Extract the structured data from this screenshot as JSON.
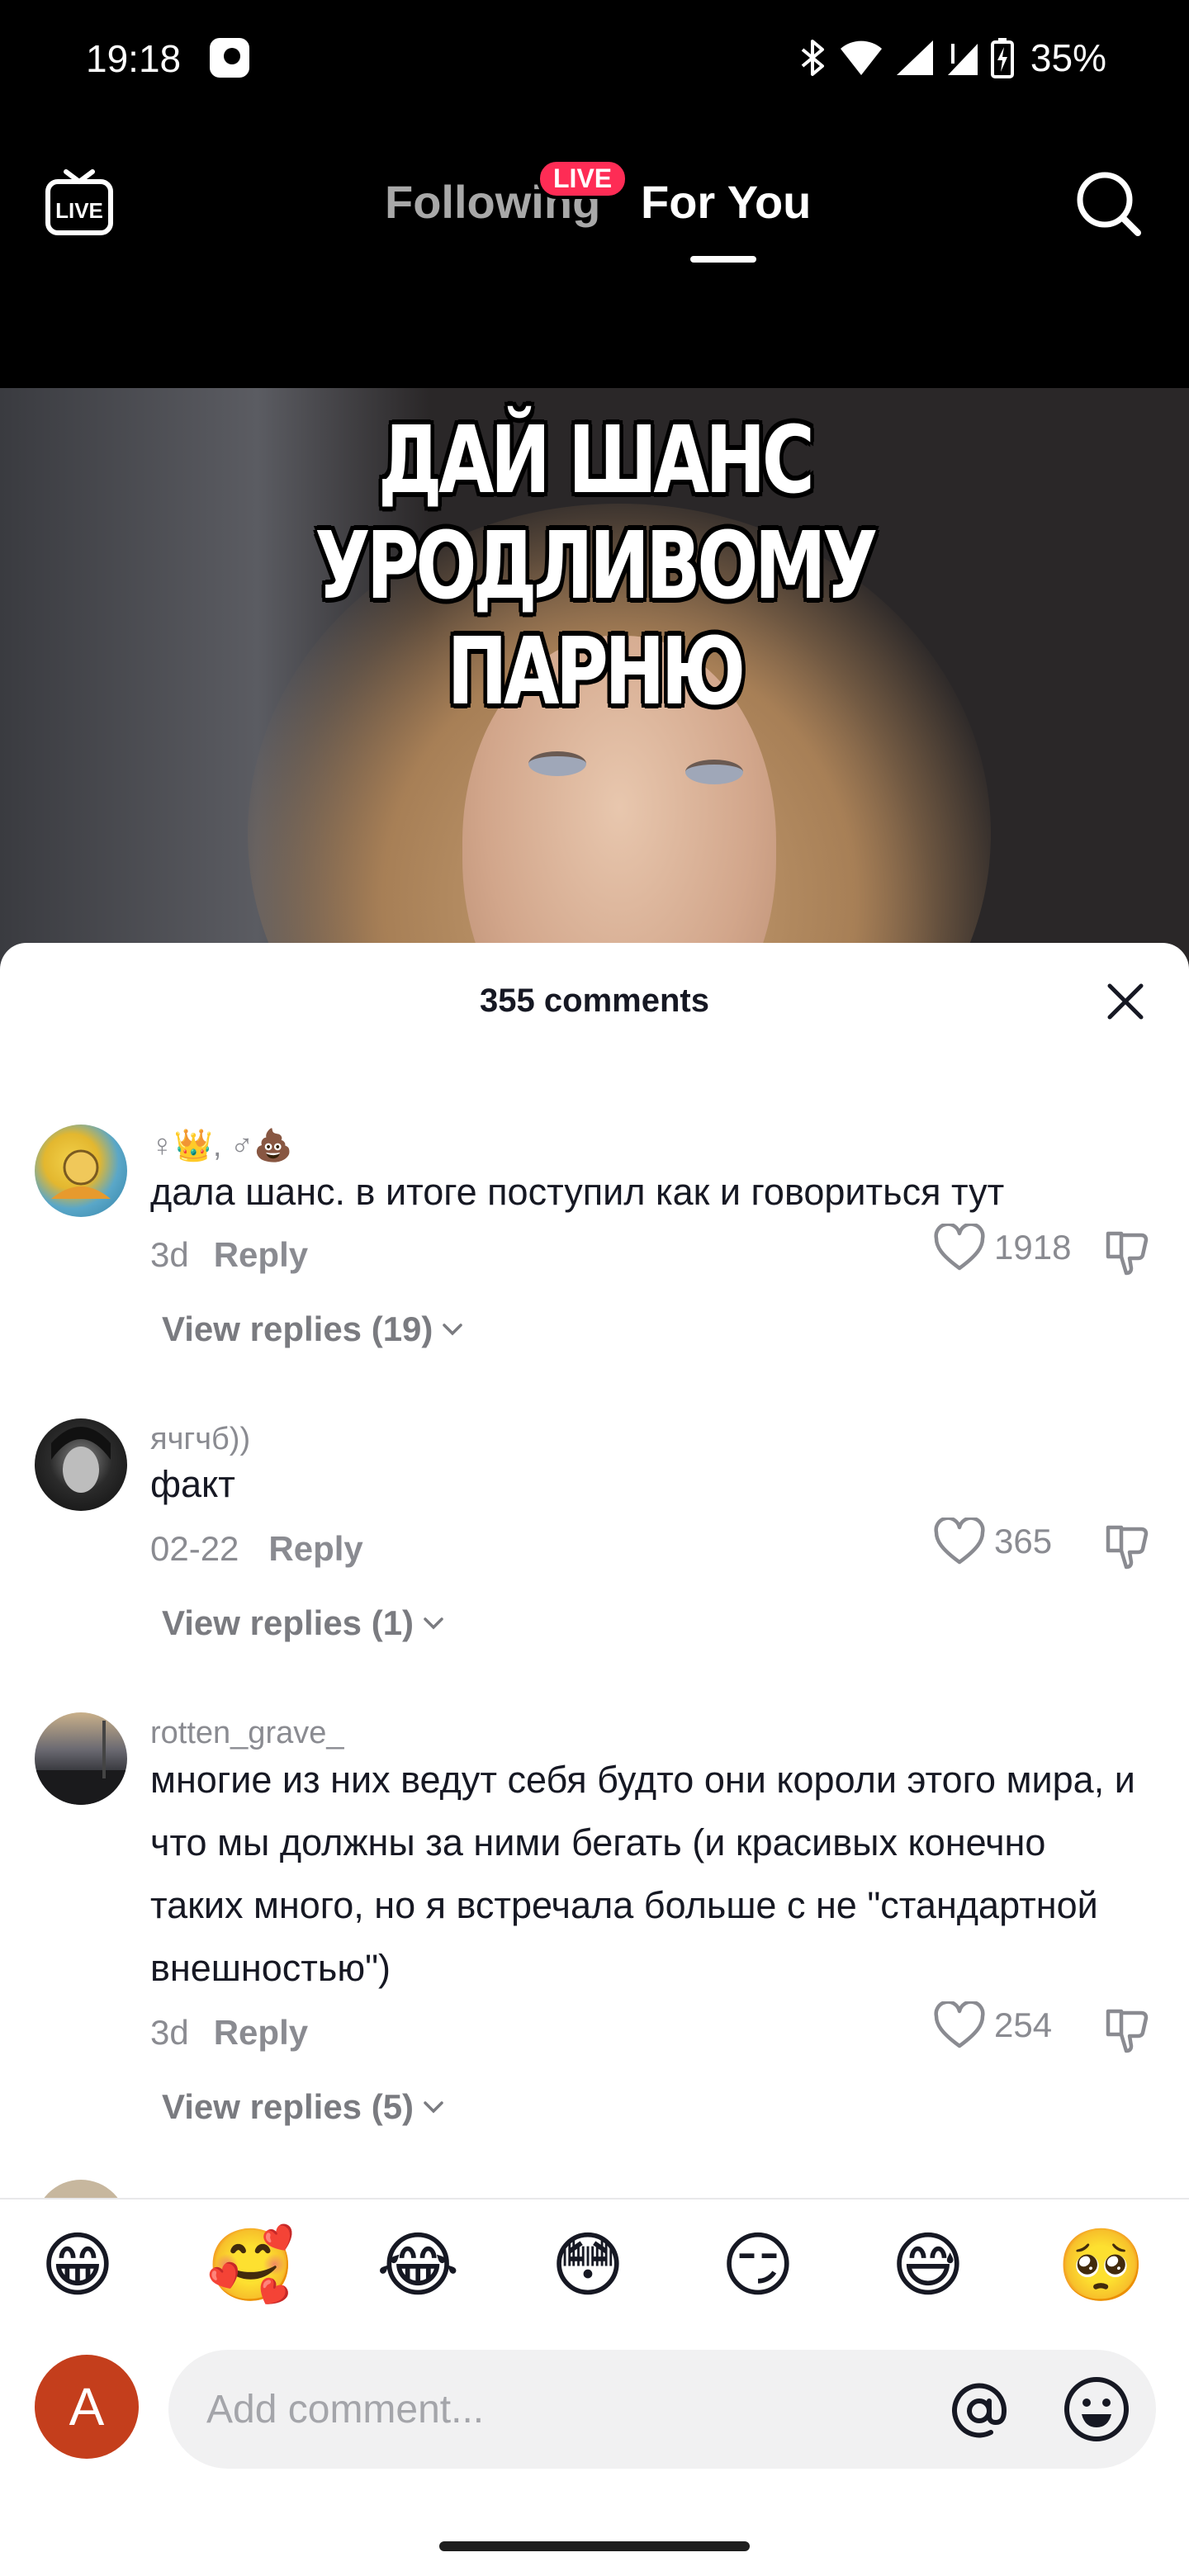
{
  "status_bar": {
    "time": "19:18",
    "battery": "35%"
  },
  "top_nav": {
    "tab_following": "Following",
    "live_badge": "LIVE",
    "tab_for_you": "For You",
    "live_icon_text": "LIVE"
  },
  "video": {
    "caption_line1": "ДАЙ ШАНС УРОДЛИВОМУ",
    "caption_line2": "ПАРНЮ"
  },
  "comments_sheet": {
    "title": "355 comments",
    "comments": [
      {
        "username": "♀👑, ♂💩",
        "text": "дала шанс. в итоге поступил как и говориться тут",
        "time": "3d",
        "reply_label": "Reply",
        "likes": "1918",
        "view_replies": "View replies (19)"
      },
      {
        "username": "ячгчб))",
        "text": "факт",
        "time": "02-22",
        "reply_label": "Reply",
        "likes": "365",
        "view_replies": "View replies (1)"
      },
      {
        "username": "rotten_grave_",
        "text": "многие из них ведут себя будто они короли этого мира, и что мы должны за ними бегать (и красивых конечно таких много, но я встречала больше с не \"стандартной внешностью\")",
        "time": "3d",
        "reply_label": "Reply",
        "likes": "254",
        "view_replies": "View replies (5)"
      }
    ],
    "quick_emojis": [
      "😁",
      "🥰",
      "😂",
      "😳",
      "😏",
      "😅",
      "🥺"
    ],
    "user_avatar_letter": "A",
    "input_placeholder": "Add comment..."
  },
  "colors": {
    "accent": "#fe2c55",
    "avatar_user": "#c43e1c"
  }
}
